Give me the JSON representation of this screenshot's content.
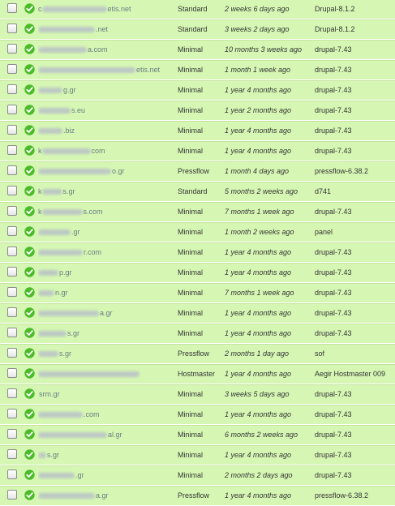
{
  "rows": [
    {
      "site_left": "c",
      "site_right": "etis.net",
      "profile": "Standard",
      "updated": "2 weeks 6 days ago",
      "platform": "Drupal-8.1.2"
    },
    {
      "site_left": "",
      "site_right": ".net",
      "profile": "Standard",
      "updated": "3 weeks 2 days ago",
      "platform": "Drupal-8.1.2"
    },
    {
      "site_left": "",
      "site_right": "a.com",
      "profile": "Minimal",
      "updated": "10 months 3 weeks ago",
      "platform": "drupal-7.43"
    },
    {
      "site_left": "",
      "site_right": "etis.net",
      "profile": "Minimal",
      "updated": "1 month 1 week ago",
      "platform": "drupal-7.43"
    },
    {
      "site_left": "",
      "site_right": "g.gr",
      "profile": "Minimal",
      "updated": "1 year 4 months ago",
      "platform": "drupal-7.43"
    },
    {
      "site_left": "",
      "site_right": "s.eu",
      "profile": "Minimal",
      "updated": "1 year 2 months ago",
      "platform": "drupal-7.43"
    },
    {
      "site_left": "",
      "site_right": ".biz",
      "profile": "Minimal",
      "updated": "1 year 4 months ago",
      "platform": "drupal-7.43"
    },
    {
      "site_left": "k",
      "site_right": "com",
      "profile": "Minimal",
      "updated": "1 year 4 months ago",
      "platform": "drupal-7.43"
    },
    {
      "site_left": "",
      "site_right": "o.gr",
      "profile": "Pressflow",
      "updated": "1 month 4 days ago",
      "platform": "pressflow-6.38.2"
    },
    {
      "site_left": "k",
      "site_right": "s.gr",
      "profile": "Standard",
      "updated": "5 months 2 weeks ago",
      "platform": "d741"
    },
    {
      "site_left": "k",
      "site_right": "s.com",
      "profile": "Minimal",
      "updated": "7 months 1 week ago",
      "platform": "drupal-7.43"
    },
    {
      "site_left": "",
      "site_right": ".gr",
      "profile": "Minimal",
      "updated": "1 month 2 weeks ago",
      "platform": "panel"
    },
    {
      "site_left": "",
      "site_right": "r.com",
      "profile": "Minimal",
      "updated": "1 year 4 months ago",
      "platform": "drupal-7.43"
    },
    {
      "site_left": "",
      "site_right": "p.gr",
      "profile": "Minimal",
      "updated": "1 year 4 months ago",
      "platform": "drupal-7.43"
    },
    {
      "site_left": "",
      "site_right": "n.gr",
      "profile": "Minimal",
      "updated": "7 months 1 week ago",
      "platform": "drupal-7.43"
    },
    {
      "site_left": "",
      "site_right": "a.gr",
      "profile": "Minimal",
      "updated": "1 year 4 months ago",
      "platform": "drupal-7.43"
    },
    {
      "site_left": "",
      "site_right": "s.gr",
      "profile": "Minimal",
      "updated": "1 year 4 months ago",
      "platform": "drupal-7.43"
    },
    {
      "site_left": "",
      "site_right": "s.gr",
      "profile": "Pressflow",
      "updated": "2 months 1 day ago",
      "platform": "sof"
    },
    {
      "site_left": "",
      "site_right": "",
      "profile": "Hostmaster",
      "updated": "1 year 4 months ago",
      "platform": "Aegir Hostmaster 009"
    },
    {
      "site_left": "",
      "site_right": "srm.gr",
      "profile": "Minimal",
      "updated": "3 weeks 5 days ago",
      "platform": "drupal-7.43"
    },
    {
      "site_left": "",
      "site_right": ".com",
      "profile": "Minimal",
      "updated": "1 year 4 months ago",
      "platform": "drupal-7.43"
    },
    {
      "site_left": "",
      "site_right": "al.gr",
      "profile": "Minimal",
      "updated": "6 months 2 weeks ago",
      "platform": "drupal-7.43"
    },
    {
      "site_left": "",
      "site_right": "s.gr",
      "profile": "Minimal",
      "updated": "1 year 4 months ago",
      "platform": "drupal-7.43"
    },
    {
      "site_left": "",
      "site_right": ".gr",
      "profile": "Minimal",
      "updated": "2 months 2 days ago",
      "platform": "drupal-7.43"
    },
    {
      "site_left": "",
      "site_right": "a.gr",
      "profile": "Pressflow",
      "updated": "1 year 4 months ago",
      "platform": "pressflow-6.38.2"
    }
  ],
  "icons": {
    "status": "check-circle-icon",
    "select": "checkbox-icon"
  },
  "colors": {
    "row_bg": "#d6f7b4",
    "row_border": "#c2e49c",
    "status_icon": "#4cbb2a",
    "site_text": "#6a7c82"
  }
}
